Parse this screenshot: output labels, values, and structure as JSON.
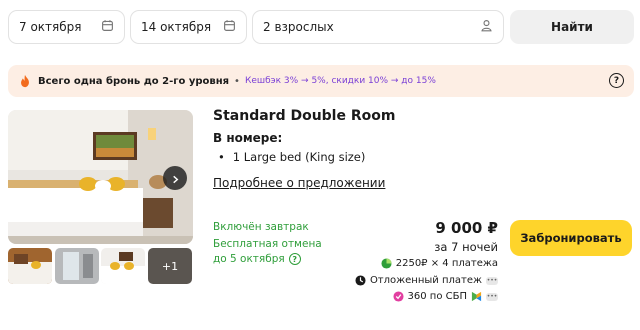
{
  "search": {
    "checkin": "7 октября",
    "checkout": "14 октября",
    "guests": "2 взрослых",
    "find_label": "Найти"
  },
  "promo": {
    "main_text": "Всего одна бронь до 2-го уровня",
    "separator": "•",
    "cashback_text": "Кешбэк 3% → 5%, скидки 10% → до 15%",
    "help_symbol": "?"
  },
  "gallery": {
    "more_label": "+1"
  },
  "room": {
    "title": "Standard Double Room",
    "in_room_label": "В номере:",
    "beds": [
      "1 Large bed (King size)"
    ],
    "details_link": "Подробнее о предложении"
  },
  "perks": {
    "breakfast": "Включён завтрак",
    "cancel_line1": "Бесплатная отмена",
    "cancel_line2": "до 5 октября",
    "info_symbol": "?"
  },
  "pricing": {
    "price": "9 000 ₽",
    "nights": "за 7 ночей",
    "split": "2250₽ × 4 платежа",
    "later": "Отложенный платеж",
    "sbp": "360 по СБП",
    "more_symbol": "•••"
  },
  "book_label": "Забронировать",
  "colors": {
    "accent_yellow": "#fed42b",
    "green": "#2f9e3a",
    "promo_bg": "#fdeee4",
    "purple": "#7a3fd6"
  },
  "icons": {
    "checkin": "calendar-icon",
    "checkout": "calendar-icon",
    "guests": "person-icon",
    "promo": "fire-icon",
    "next": "chevron-right-icon",
    "split": "split-payment-icon",
    "later": "deferred-payment-icon",
    "sbp": "sbp-icon"
  }
}
